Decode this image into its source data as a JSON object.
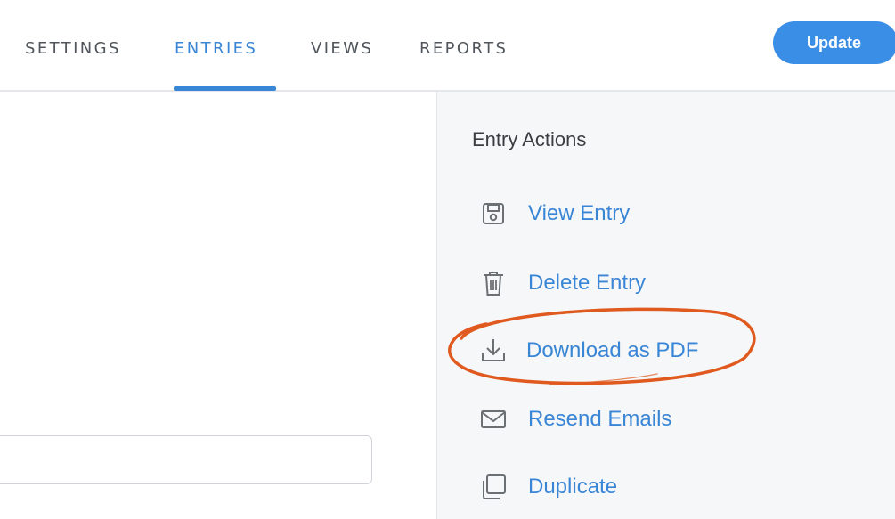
{
  "tabs": [
    {
      "label": "SETTINGS",
      "active": false
    },
    {
      "label": "ENTRIES",
      "active": true
    },
    {
      "label": "VIEWS",
      "active": false
    },
    {
      "label": "REPORTS",
      "active": false
    }
  ],
  "header": {
    "update_label": "Update"
  },
  "sidebar": {
    "title": "Entry Actions",
    "actions": [
      {
        "label": "View Entry",
        "icon": "floppy-disk-icon"
      },
      {
        "label": "Delete Entry",
        "icon": "trash-icon"
      },
      {
        "label": "Download as PDF",
        "icon": "download-icon",
        "highlighted": true
      },
      {
        "label": "Resend Emails",
        "icon": "envelope-icon"
      },
      {
        "label": "Duplicate",
        "icon": "duplicate-icon"
      }
    ]
  },
  "main": {
    "input_value": ""
  },
  "colors": {
    "accent": "#3a86d6",
    "button": "#3b8ee6",
    "highlight_annotation": "#e05a1f",
    "sidebar_bg": "#f6f7f8"
  }
}
